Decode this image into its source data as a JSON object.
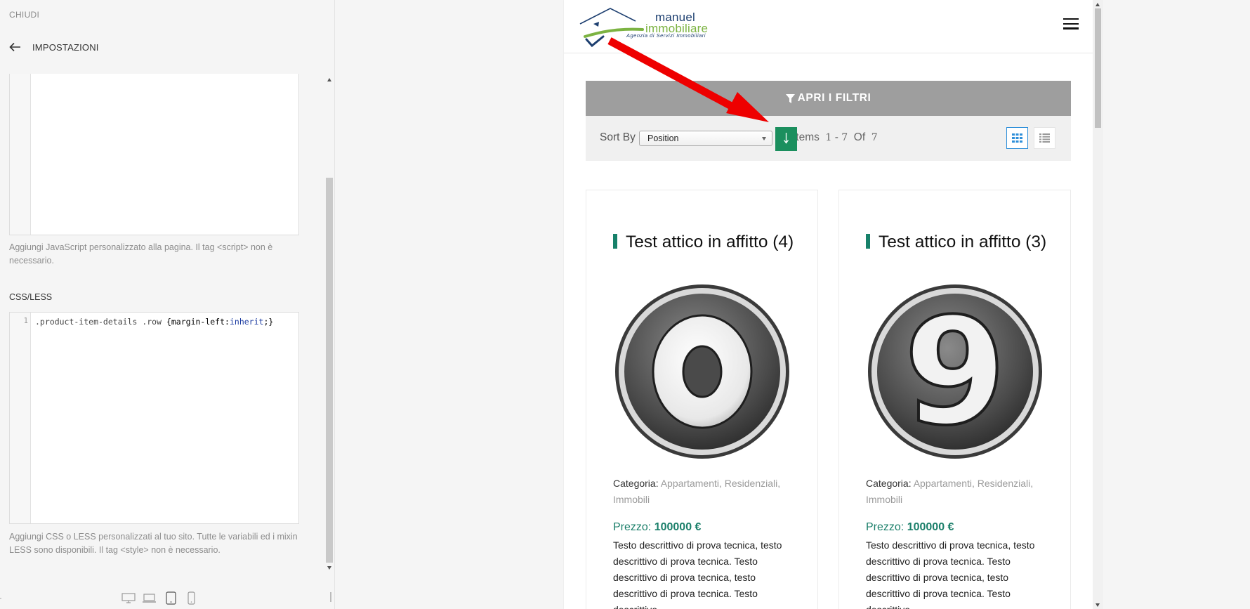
{
  "panel": {
    "close_label": "CHIUDI",
    "section_title": "IMPOSTAZIONI",
    "js_help": "Aggiungi JavaScript personalizzato alla pagina. Il tag <script> non è necessario.",
    "css_label": "CSS/LESS",
    "css_line_number": "1",
    "css_code": {
      "selector": ".product-item-details .row ",
      "open": "{",
      "property": "margin-left:",
      "value": "inherit",
      "close": ";}"
    },
    "css_help": "Aggiungi CSS o LESS personalizzati al tuo sito. Tutte le variabili ed i mixin LESS sono disponibili. Il tag <style> non è necessario.",
    "devices": [
      "desktop-icon",
      "laptop-icon",
      "tablet-icon",
      "mobile-icon"
    ]
  },
  "site": {
    "logo": {
      "title": "manuel",
      "subtitle": "immobiliare",
      "tagline": "Agenzia di Servizi Immobiliari"
    },
    "filter_button": "APRI I FILTRI",
    "toolbar": {
      "sort_label": "Sort By",
      "sort_value": "Position",
      "items_label": "Items",
      "items_from": "1",
      "items_to": "7",
      "items_of": "Of",
      "items_total": "7"
    },
    "products": [
      {
        "title": "Test attico in affitto (4)",
        "image_digit": "0",
        "category_label": "Categoria:",
        "categories": "Appartamenti, Residenziali, Immobili",
        "price_label": "Prezzo:",
        "price": "100000 €",
        "description": "Testo descrittivo di prova tecnica, testo descrittivo di prova tecnica. Testo descrittivo di prova tecnica, testo descrittivo di prova tecnica. Testo descrittivo"
      },
      {
        "title": "Test attico in affitto (3)",
        "image_digit": "9",
        "category_label": "Categoria:",
        "categories": "Appartamenti, Residenziali, Immobili",
        "price_label": "Prezzo:",
        "price": "100000 €",
        "description": "Testo descrittivo di prova tecnica, testo descrittivo di prova tecnica. Testo descrittivo di prova tecnica, testo descrittivo di prova tecnica. Testo descrittivo"
      }
    ]
  },
  "colors": {
    "accent_green": "#1b8f5e",
    "title_bar": "#17816a",
    "annotation_arrow": "#ee0000",
    "filter_bar": "#9e9e9e"
  }
}
